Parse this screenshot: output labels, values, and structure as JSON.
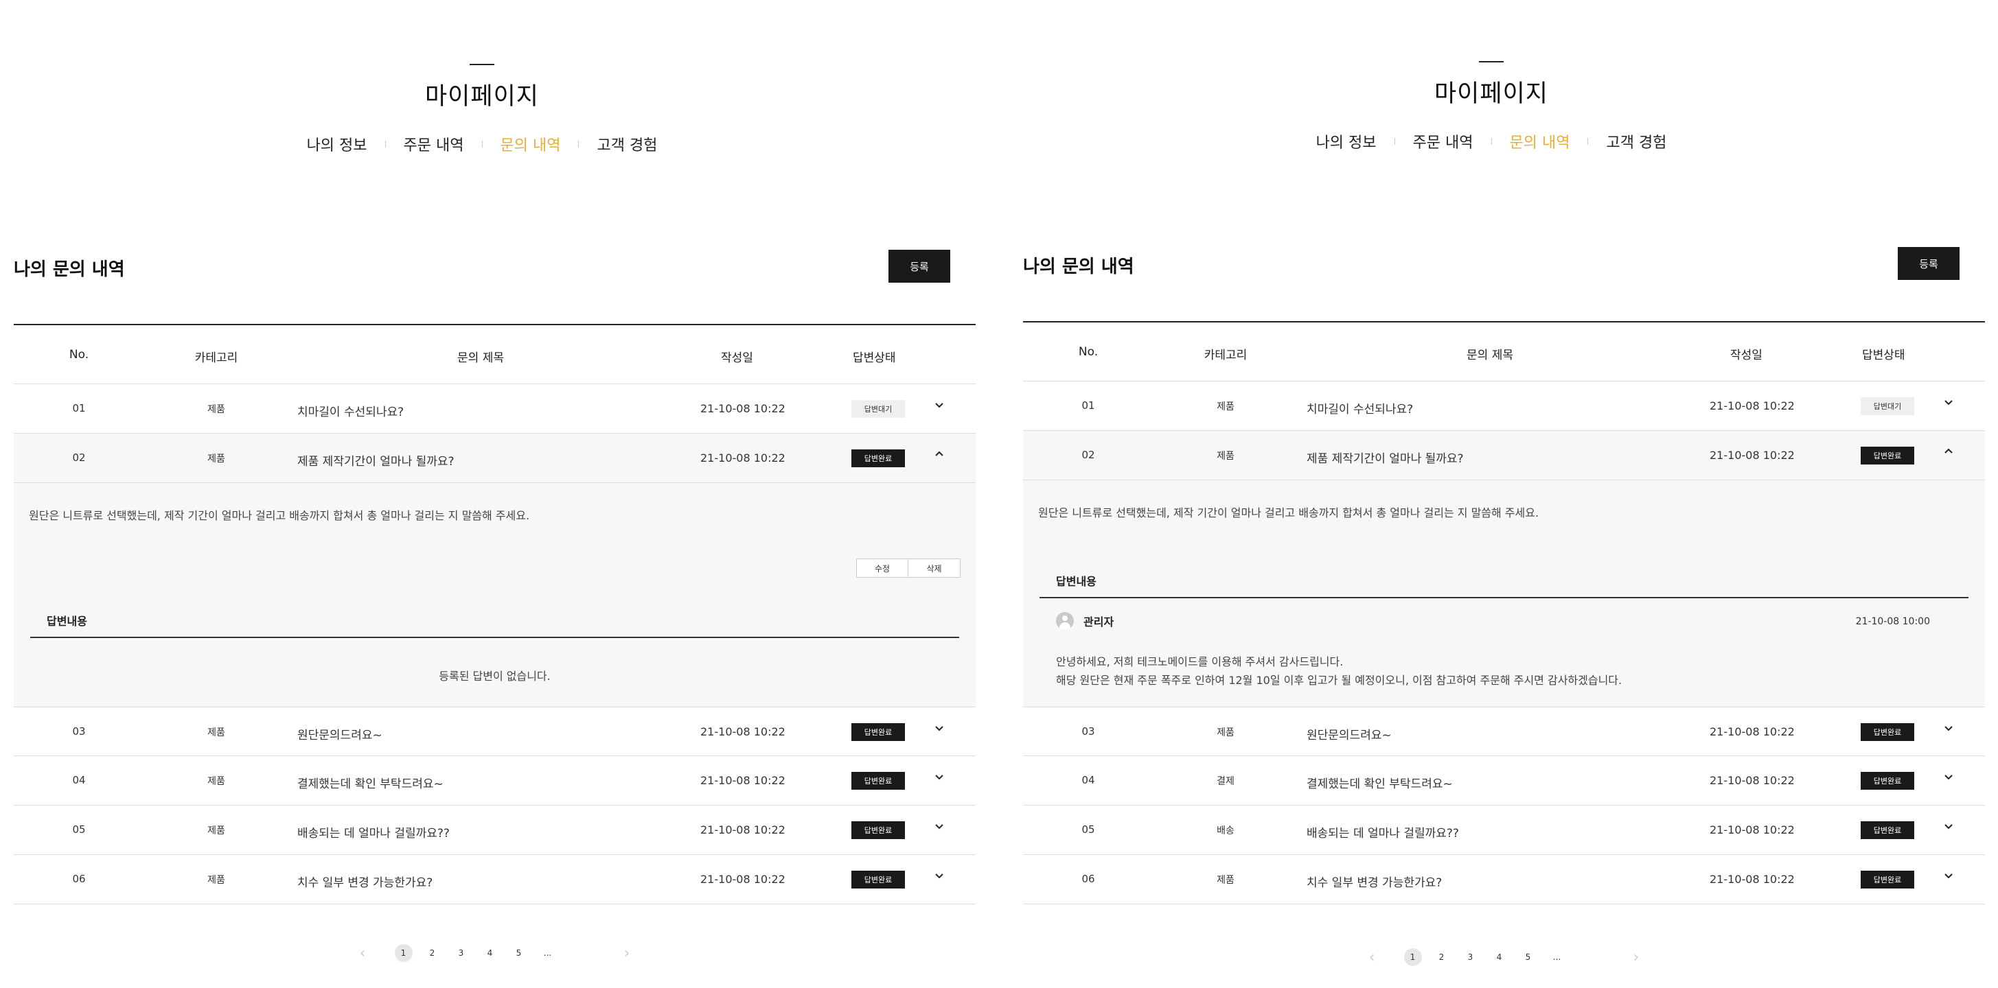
{
  "header": {
    "title": "마이페이지",
    "tabs": [
      {
        "label": "나의 정보"
      },
      {
        "label": "주문 내역"
      },
      {
        "label": "문의 내역"
      },
      {
        "label": "고객 경험"
      }
    ],
    "active_tab": "문의 내역",
    "accent_color": "#e9ad3c"
  },
  "section": {
    "title": "나의 문의 내역",
    "register_label": "등록"
  },
  "table": {
    "columns": [
      "No.",
      "카테고리",
      "문의 제목",
      "작성일",
      "답변상태"
    ]
  },
  "left": {
    "rows": [
      {
        "no": "01",
        "category": "제품",
        "title": "치마길이 수선되나요?",
        "date": "21-10-08 10:22",
        "status": "답변대기"
      },
      {
        "no": "02",
        "category": "제품",
        "title": "제품 제작기간이 얼마나 될까요?",
        "date": "21-10-08 10:22",
        "status": "답변완료"
      },
      {
        "no": "03",
        "category": "제품",
        "title": "원단문의드려요~",
        "date": "21-10-08 10:22",
        "status": "답변완료"
      },
      {
        "no": "04",
        "category": "제품",
        "title": "결제했는데 확인 부탁드려요~",
        "date": "21-10-08 10:22",
        "status": "답변완료"
      },
      {
        "no": "05",
        "category": "제품",
        "title": "배송되는 데 얼마나 걸릴까요??",
        "date": "21-10-08 10:22",
        "status": "답변완료"
      },
      {
        "no": "06",
        "category": "제품",
        "title": "치수 일부 변경 가능한가요?",
        "date": "21-10-08 10:22",
        "status": "답변완료"
      }
    ],
    "detail": {
      "question": "원단은 니트류로 선택했는데, 제작 기간이 얼마나 걸리고 배송까지 합쳐서 총 얼마나 걸리는 지 말씀해 주세요.",
      "edit_label": "수정",
      "delete_label": "삭제",
      "answer_label": "답변내용",
      "no_answer": "등록된 답변이 없습니다."
    }
  },
  "right": {
    "rows": [
      {
        "no": "01",
        "category": "제품",
        "title": "치마길이 수선되나요?",
        "date": "21-10-08 10:22",
        "status": "답변대기"
      },
      {
        "no": "02",
        "category": "제품",
        "title": "제품 제작기간이 얼마나 될까요?",
        "date": "21-10-08 10:22",
        "status": "답변완료"
      },
      {
        "no": "03",
        "category": "제품",
        "title": "원단문의드려요~",
        "date": "21-10-08 10:22",
        "status": "답변완료"
      },
      {
        "no": "04",
        "category": "결제",
        "title": "결제했는데 확인 부탁드려요~",
        "date": "21-10-08 10:22",
        "status": "답변완료"
      },
      {
        "no": "05",
        "category": "배송",
        "title": "배송되는 데 얼마나 걸릴까요??",
        "date": "21-10-08 10:22",
        "status": "답변완료"
      },
      {
        "no": "06",
        "category": "제품",
        "title": "치수 일부 변경 가능한가요?",
        "date": "21-10-08 10:22",
        "status": "답변완료"
      }
    ],
    "detail": {
      "question": "원단은 니트류로 선택했는데, 제작 기간이 얼마나 걸리고 배송까지 합쳐서 총 얼마나 걸리는 지 말씀해 주세요.",
      "answer_label": "답변내용",
      "admin_name": "관리자",
      "admin_date": "21-10-08  10:00",
      "answer_line1": "안녕하세요, 저희 테크노메이드를 이용해 주셔서 감사드립니다.",
      "answer_line2": "해당 원단은 현재 주문 폭주로 인하여 12월 10일 이후 입고가 될 예정이오니, 이점 참고하여 주문해 주시면 감사하겠습니다."
    }
  },
  "pagination": {
    "prev": "‹",
    "next": "›",
    "pages": [
      "1",
      "2",
      "3",
      "4",
      "5",
      "..."
    ],
    "current": "1"
  }
}
